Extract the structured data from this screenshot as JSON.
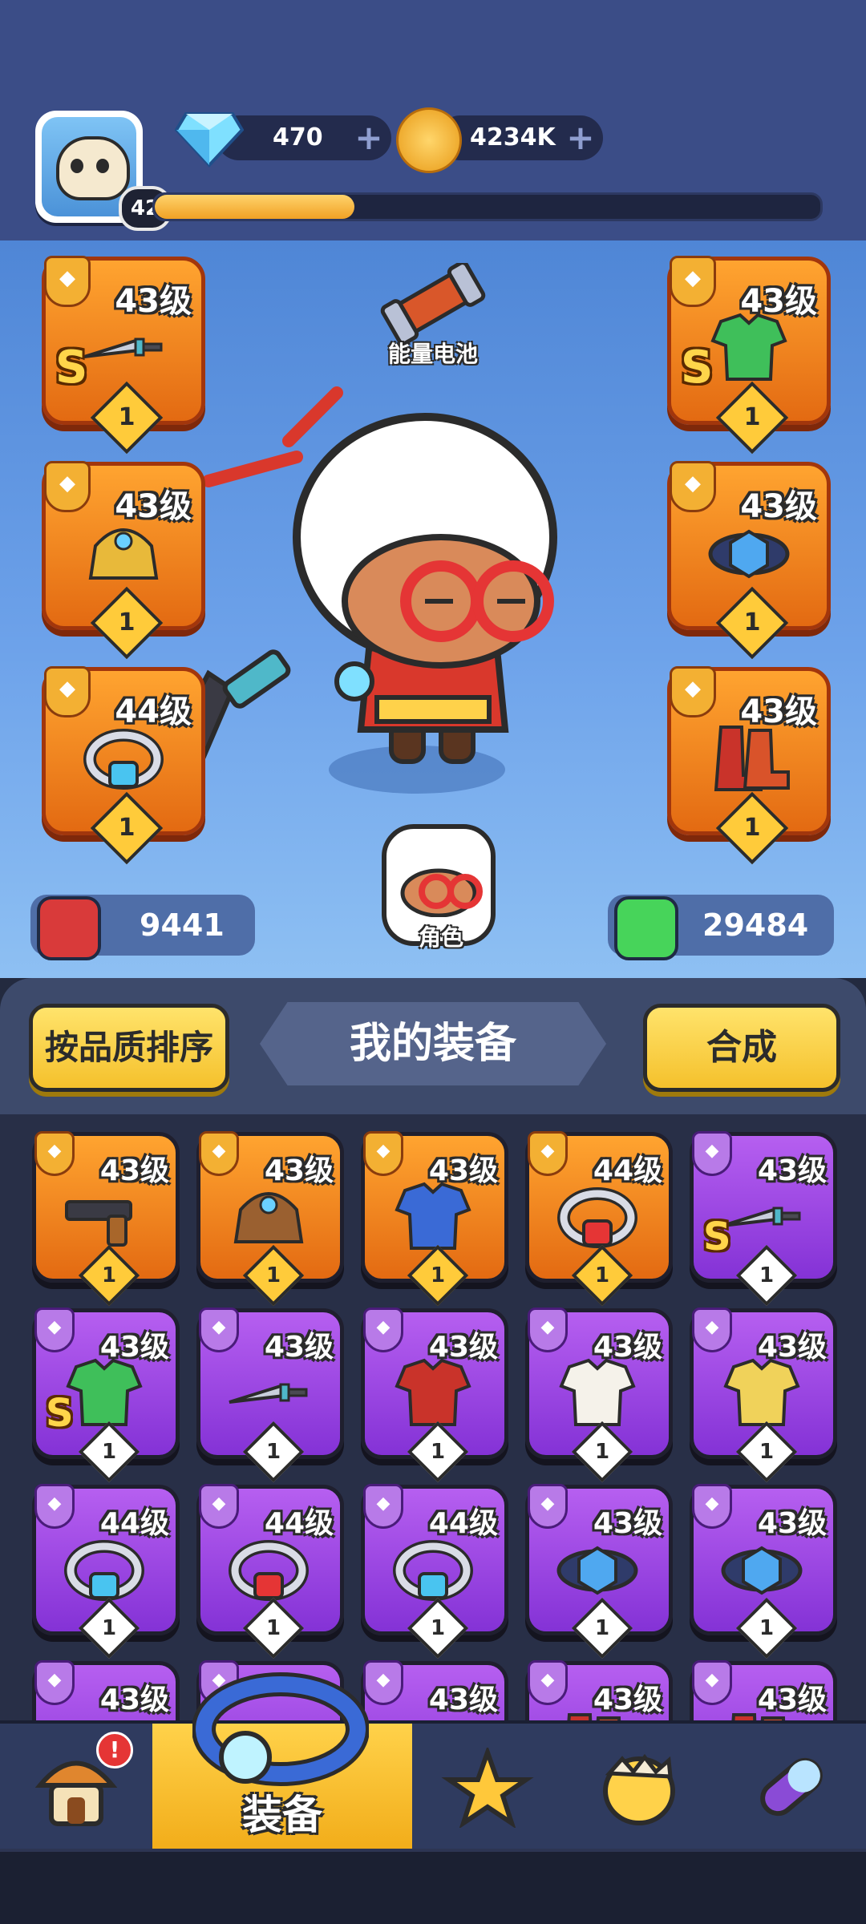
{
  "header": {
    "player_level": "42",
    "xp_progress": 0.3,
    "gems": "470",
    "coins": "4234K",
    "gem_color": "#8fe3ff",
    "coin_color": "#f5b82c"
  },
  "stage": {
    "battery_label": "能量电池",
    "role_label": "角色",
    "attack_value": "9441",
    "health_value": "29484",
    "attack_color": "#d93a3a",
    "health_color": "#47d45a",
    "equipped": [
      {
        "slot": "weapon",
        "level": "43级",
        "grade": "S",
        "count": "1",
        "icon": "dagger-icon",
        "type_icon": "gun-type-icon"
      },
      {
        "slot": "armor",
        "level": "43级",
        "grade": "S",
        "count": "1",
        "icon": "leaf-armor-icon",
        "type_icon": "armor-type-icon"
      },
      {
        "slot": "gloves",
        "level": "43级",
        "grade": "",
        "count": "1",
        "icon": "golden-gauntlet-icon",
        "type_icon": "glove-type-icon"
      },
      {
        "slot": "belt",
        "level": "43级",
        "grade": "",
        "count": "1",
        "icon": "lightning-belt-icon",
        "type_icon": "belt-type-icon"
      },
      {
        "slot": "necklace",
        "level": "44级",
        "grade": "",
        "count": "1",
        "icon": "gem-ring-icon",
        "type_icon": "necklace-type-icon"
      },
      {
        "slot": "boots",
        "level": "43级",
        "grade": "",
        "count": "1",
        "icon": "red-boots-icon",
        "type_icon": "boot-type-icon"
      }
    ]
  },
  "inventory": {
    "sort_label": "按品质排序",
    "title": "我的装备",
    "merge_label": "合成",
    "items": [
      {
        "level": "43级",
        "grade": "",
        "count": "1",
        "rarity": "orange",
        "icon": "pistol-icon"
      },
      {
        "level": "43级",
        "grade": "",
        "count": "1",
        "rarity": "orange",
        "icon": "brown-gauntlet-icon"
      },
      {
        "level": "43级",
        "grade": "",
        "count": "1",
        "rarity": "orange",
        "icon": "blue-cape-icon"
      },
      {
        "level": "44级",
        "grade": "",
        "count": "1",
        "rarity": "orange",
        "icon": "red-necklace-icon"
      },
      {
        "level": "43级",
        "grade": "S",
        "count": "1",
        "rarity": "purple",
        "icon": "dagger-icon"
      },
      {
        "level": "43级",
        "grade": "S",
        "count": "1",
        "rarity": "purple",
        "icon": "leaf-armor-icon"
      },
      {
        "level": "43级",
        "grade": "",
        "count": "1",
        "rarity": "purple",
        "icon": "knife-icon"
      },
      {
        "level": "43级",
        "grade": "",
        "count": "1",
        "rarity": "purple",
        "icon": "red-vest-icon"
      },
      {
        "level": "43级",
        "grade": "",
        "count": "1",
        "rarity": "purple",
        "icon": "white-robe-icon"
      },
      {
        "level": "43级",
        "grade": "",
        "count": "1",
        "rarity": "purple",
        "icon": "gold-coat-icon"
      },
      {
        "level": "44级",
        "grade": "",
        "count": "1",
        "rarity": "purple",
        "icon": "silver-ring-icon"
      },
      {
        "level": "44级",
        "grade": "",
        "count": "1",
        "rarity": "purple",
        "icon": "ruby-ring-icon"
      },
      {
        "level": "44级",
        "grade": "",
        "count": "1",
        "rarity": "purple",
        "icon": "gold-amulet-icon"
      },
      {
        "level": "43级",
        "grade": "",
        "count": "1",
        "rarity": "purple",
        "icon": "lightning-belt-icon"
      },
      {
        "level": "43级",
        "grade": "",
        "count": "1",
        "rarity": "purple",
        "icon": "eye-belt-icon"
      },
      {
        "level": "43级",
        "grade": "",
        "count": "",
        "rarity": "purple",
        "icon": "belt-icon"
      },
      {
        "level": "",
        "grade": "",
        "count": "",
        "rarity": "purple",
        "icon": "glove-icon"
      },
      {
        "level": "43级",
        "grade": "",
        "count": "",
        "rarity": "purple",
        "icon": "glove-icon"
      },
      {
        "level": "43级",
        "grade": "",
        "count": "",
        "rarity": "purple",
        "icon": "boot-icon"
      },
      {
        "level": "43级",
        "grade": "",
        "count": "",
        "rarity": "purple",
        "icon": "boot-icon"
      }
    ]
  },
  "nav": {
    "shop_badge": "!",
    "equip_label": "装备",
    "tabs": [
      {
        "name": "shop-tab",
        "icon": "mushroom-house-icon"
      },
      {
        "name": "equipment-tab",
        "icon": "ring-icon"
      },
      {
        "name": "challenge-tab",
        "icon": "star-guns-icon"
      },
      {
        "name": "pets-tab",
        "icon": "chick-egg-icon"
      },
      {
        "name": "talent-tab",
        "icon": "capsule-icon"
      }
    ]
  }
}
